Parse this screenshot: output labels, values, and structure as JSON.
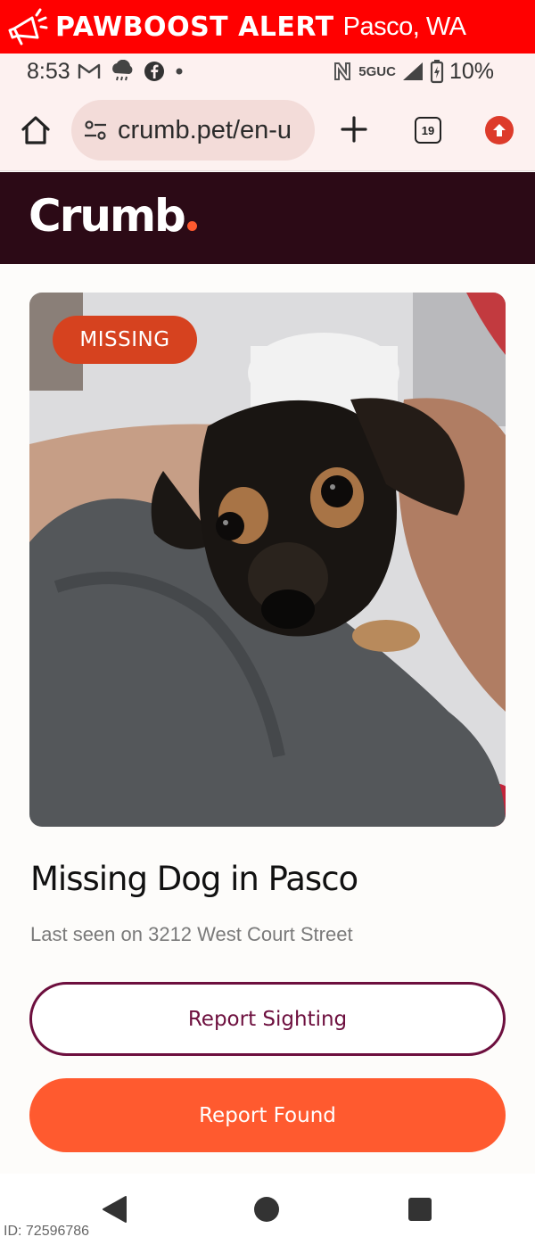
{
  "alert_banner": {
    "title": "PAWBOOST ALERT",
    "location": "Pasco, WA",
    "background": "#ff0000",
    "icon": "megaphone-icon"
  },
  "status_bar": {
    "time": "8:53",
    "left_icons": [
      "gmail-icon",
      "weather-rain-icon",
      "facebook-icon",
      "dot-icon"
    ],
    "right_icons": [
      "nfc-icon",
      "signal-icon",
      "battery-charging-icon"
    ],
    "network": "5GUC",
    "battery": "10%"
  },
  "browser": {
    "url": "crumb.pet/en-u",
    "tab_count": "19",
    "icons": [
      "home-icon",
      "site-settings-icon",
      "plus-icon",
      "tabs-icon",
      "update-icon"
    ]
  },
  "site": {
    "logo_text": "Crumb",
    "brand_dark": "#2c0a16",
    "brand_orange": "#ff5a2f"
  },
  "listing": {
    "status_badge": "MISSING",
    "title": "Missing Dog in Pasco",
    "last_seen": "Last seen on 3212 West Court Street",
    "photo_description": "dog-photo"
  },
  "actions": {
    "report_sighting": "Report Sighting",
    "report_found": "Report Found"
  },
  "footer": {
    "id_label": "ID: 72596786"
  }
}
